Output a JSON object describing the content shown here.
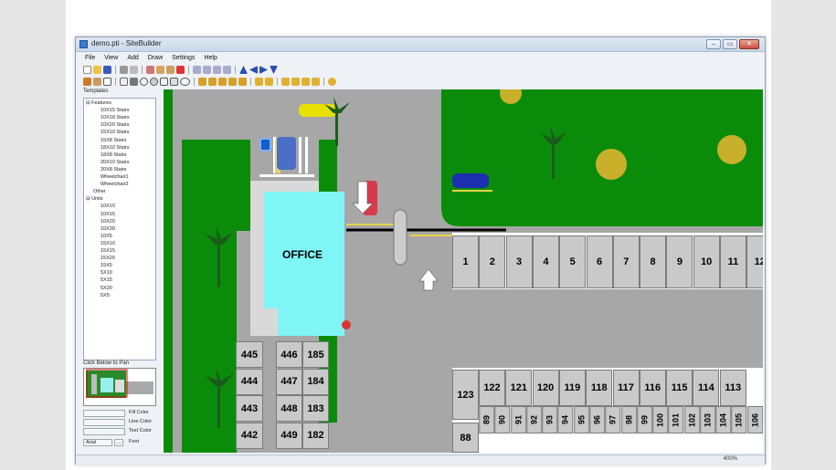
{
  "window": {
    "title": "demo.pti - SiteBuilder",
    "buttons": [
      "–",
      "▭",
      "✕"
    ]
  },
  "menu": [
    "File",
    "View",
    "Add",
    "Draw",
    "Settings",
    "Help"
  ],
  "left_panel": {
    "templates_label": "Templates",
    "tree": [
      {
        "label": "Features",
        "level": 0,
        "toggle": "⊟"
      },
      {
        "label": "10X15 Stairs",
        "level": 2
      },
      {
        "label": "10X18 Stairs",
        "level": 2
      },
      {
        "label": "10X20 Stairs",
        "level": 2
      },
      {
        "label": "15X10 Stairs",
        "level": 2
      },
      {
        "label": "15X8 Stairs",
        "level": 2
      },
      {
        "label": "18X10 Stairs",
        "level": 2
      },
      {
        "label": "18X8 Stairs",
        "level": 2
      },
      {
        "label": "20X10 Stairs",
        "level": 2
      },
      {
        "label": "20X8 Stairs",
        "level": 2
      },
      {
        "label": "Wheelchair1",
        "level": 2
      },
      {
        "label": "Wheelchair2",
        "level": 2
      },
      {
        "label": "Other",
        "level": 1
      },
      {
        "label": "Units",
        "level": 0,
        "toggle": "⊟"
      },
      {
        "label": "10X10",
        "level": 2
      },
      {
        "label": "10X15",
        "level": 2
      },
      {
        "label": "10X20",
        "level": 2
      },
      {
        "label": "10X30",
        "level": 2
      },
      {
        "label": "10X5",
        "level": 2
      },
      {
        "label": "15X10",
        "level": 2
      },
      {
        "label": "15X15",
        "level": 2
      },
      {
        "label": "15X20",
        "level": 2
      },
      {
        "label": "15X5",
        "level": 2
      },
      {
        "label": "5X10",
        "level": 2
      },
      {
        "label": "5X15",
        "level": 2
      },
      {
        "label": "5X20",
        "level": 2
      },
      {
        "label": "5X5",
        "level": 2
      }
    ],
    "pan_label": "Click Below to Pan",
    "fill_color_label": "Fill Color",
    "line_color_label": "Line Color",
    "text_color_label": "Text Color",
    "font_value": "Arial",
    "font_button": "...",
    "font_label": "Font"
  },
  "map": {
    "office_label": "OFFICE",
    "top_row_units": [
      "1",
      "2",
      "3",
      "4",
      "5",
      "6",
      "7",
      "8",
      "9",
      "10",
      "11",
      "12"
    ],
    "left_block": [
      [
        "445",
        "446",
        "185"
      ],
      [
        "444",
        "447",
        "184"
      ],
      [
        "443",
        "448",
        "183"
      ],
      [
        "442",
        "449",
        "182"
      ]
    ],
    "right_block_top": [
      "122",
      "121",
      "120",
      "119",
      "118",
      "117",
      "116",
      "115",
      "114",
      "113"
    ],
    "right_block_bottom": [
      "89",
      "90",
      "91",
      "92",
      "93",
      "94",
      "95",
      "96",
      "97",
      "98",
      "99",
      "100",
      "101",
      "102",
      "103",
      "104",
      "105",
      "106"
    ],
    "unit_123": "123",
    "unit_88": "88"
  },
  "status": {
    "zoom": "400%"
  },
  "colors": {
    "grass": "#0a8c0a",
    "asphalt": "#a7a7a7",
    "office": "#80f5f5",
    "unit": "#c9c9c9"
  }
}
